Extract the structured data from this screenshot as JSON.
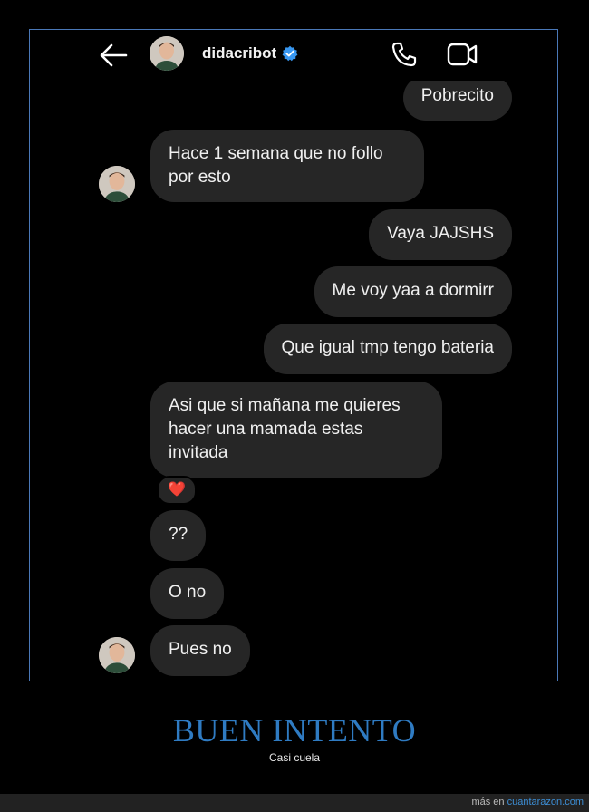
{
  "header": {
    "username": "didacribot",
    "icons": {
      "back": "arrow-left-icon",
      "verified": "verified-badge-icon",
      "call": "phone-icon",
      "video": "video-camera-icon"
    }
  },
  "messages": [
    {
      "from": "me",
      "text": "Pobrecito"
    },
    {
      "from": "them",
      "text": "Hace 1 semana que no follo\npor esto"
    },
    {
      "from": "me",
      "text": "Vaya JAJSHS"
    },
    {
      "from": "me",
      "text": "Me voy yaa a dormirr"
    },
    {
      "from": "me",
      "text": "Que igual tmp tengo bateria"
    },
    {
      "from": "them",
      "text": "Asi que si mañana me quieres\nhacer una mamada estas\ninvitada",
      "reaction": "❤️"
    },
    {
      "from": "them",
      "text": "??"
    },
    {
      "from": "them",
      "text": "O no"
    },
    {
      "from": "them",
      "text": "Pues no"
    }
  ],
  "caption": {
    "title": "BUEN INTENTO",
    "subtitle": "Casi cuela"
  },
  "footer": {
    "prefix": "más en",
    "site": "cuantarazon.com"
  },
  "colors": {
    "background": "#000000",
    "bubble": "#262626",
    "frame_border": "#4a78b8",
    "title": "#2f7bc2",
    "verified": "#3897f0"
  }
}
